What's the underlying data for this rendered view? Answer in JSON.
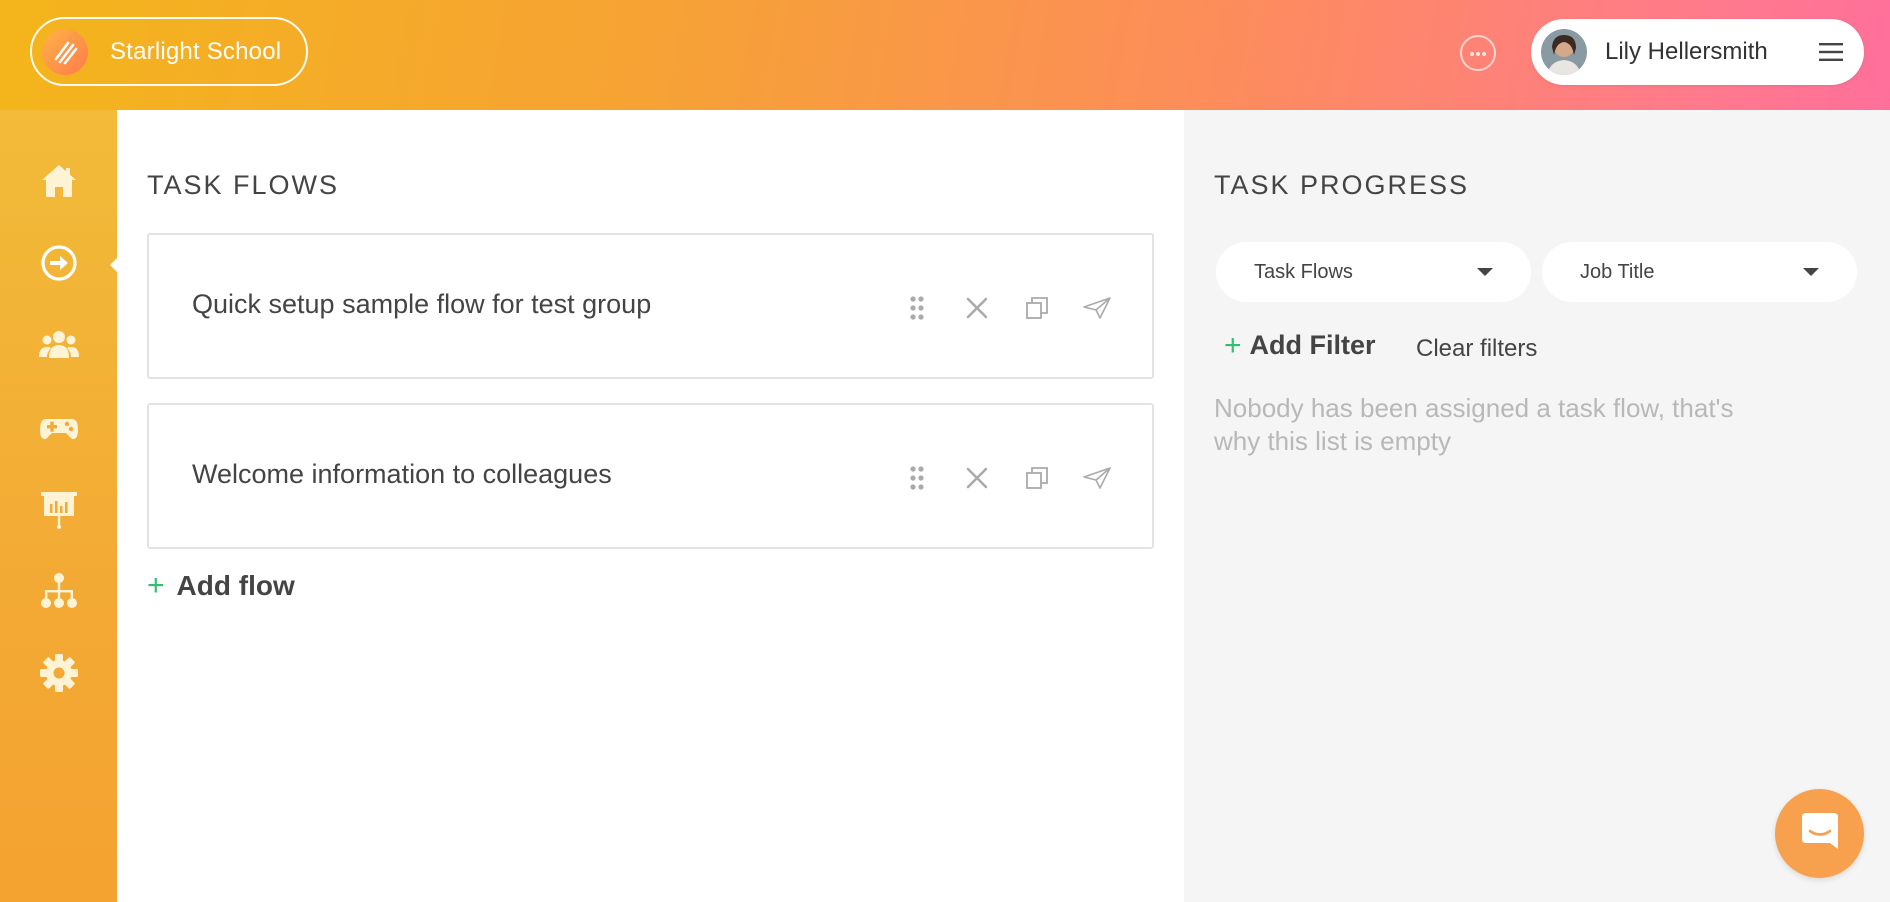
{
  "header": {
    "brand_name": "Starlight School",
    "user_name": "Lily Hellersmith"
  },
  "icons": {
    "brand": "school-logo-icon",
    "more": "more-options-icon",
    "menu": "hamburger-menu-icon",
    "nav": [
      "home-icon",
      "task-flows-icon",
      "users-icon",
      "games-icon",
      "presentation-icon",
      "hierarchy-icon",
      "settings-icon"
    ],
    "flow_actions": [
      "drag-handle-icon",
      "delete-icon",
      "duplicate-icon",
      "send-icon"
    ],
    "chat": "chat-icon"
  },
  "task_flows": {
    "title": "TASK FLOWS",
    "flows": [
      {
        "title": "Quick setup sample flow for test group"
      },
      {
        "title": "Welcome information to colleagues"
      }
    ],
    "add_label": "Add flow"
  },
  "task_progress": {
    "title": "TASK PROGRESS",
    "filters": [
      {
        "selected": "Task Flows"
      },
      {
        "selected": "Job Title"
      }
    ],
    "add_filter_label": "Add Filter",
    "clear_filters_label": "Clear filters",
    "empty_message": "Nobody has been assigned a task flow, that's why this list is empty"
  },
  "colors": {
    "accent_green": "#2fbf71",
    "sidebar": "#f3aa35",
    "chat_button": "#f7a14e"
  }
}
